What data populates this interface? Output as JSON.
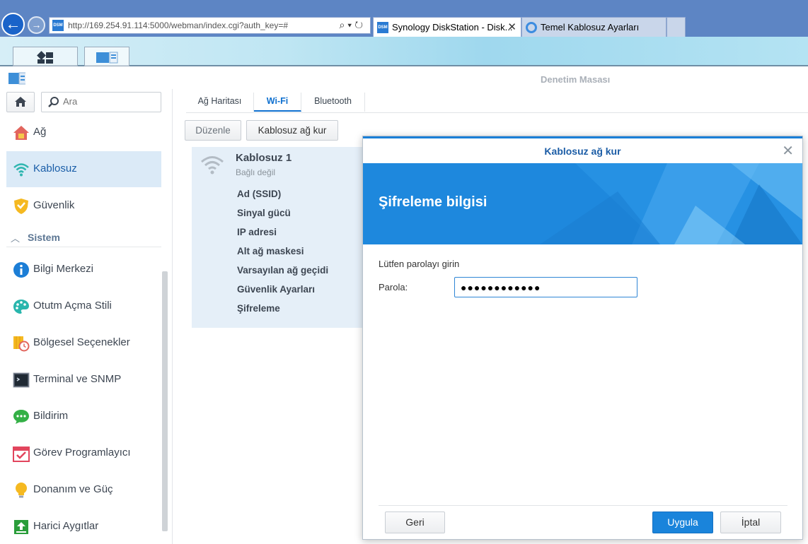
{
  "browser": {
    "address_url": "http://169.254.91.114:5000/webman/index.cgi?auth_key=#",
    "address_host": "169.254.91.114",
    "tabs": [
      {
        "label": "Synology DiskStation - Disk...",
        "close": "✕"
      },
      {
        "label": "Temel Kablosuz Ayarları"
      }
    ],
    "favicon_text": "DSM"
  },
  "window": {
    "title": "Denetim Masası"
  },
  "sidebar": {
    "search_placeholder": "Ara",
    "items_top": [
      {
        "label": "Ağ",
        "icon": "network-house-icon"
      },
      {
        "label": "Kablosuz",
        "icon": "wifi-icon",
        "active": true
      },
      {
        "label": "Güvenlik",
        "icon": "shield-icon"
      }
    ],
    "section_label": "Sistem",
    "items_system": [
      {
        "label": "Bilgi Merkezi",
        "icon": "info-icon"
      },
      {
        "label": "Otutm Açma Stili",
        "icon": "palette-icon"
      },
      {
        "label": "Bölgesel Seçenekler",
        "icon": "regional-clock-icon"
      },
      {
        "label": "Terminal ve SNMP",
        "icon": "terminal-icon"
      },
      {
        "label": "Bildirim",
        "icon": "chat-bubble-icon"
      },
      {
        "label": "Görev Programlayıcı",
        "icon": "calendar-check-icon"
      },
      {
        "label": "Donanım ve Güç",
        "icon": "lightbulb-icon"
      },
      {
        "label": "Harici Aygıtlar",
        "icon": "upload-device-icon"
      }
    ]
  },
  "main": {
    "tabs": [
      "Ağ Haritası",
      "Wi-Fi",
      "Bluetooth"
    ],
    "active_tab": "Wi-Fi",
    "toolbar": {
      "edit_label": "Düzenle",
      "setup_label": "Kablosuz ağ kur"
    },
    "wifi_panel": {
      "name": "Kablosuz 1",
      "status": "Bağlı değil",
      "fields": [
        "Ad (SSID)",
        "Sinyal gücü",
        "IP adresi",
        "Alt ağ maskesi",
        "Varsayılan ağ geçidi",
        "Güvenlik Ayarları",
        "Şifreleme"
      ]
    }
  },
  "dialog": {
    "title": "Kablosuz ağ kur",
    "heading": "Şifreleme bilgisi",
    "prompt": "Lütfen parolayı girin",
    "password_label": "Parola:",
    "password_value": "●●●●●●●●●●●●",
    "back_label": "Geri",
    "apply_label": "Uygula",
    "cancel_label": "İptal",
    "close": "✕"
  },
  "colors": {
    "accent": "#1a84db",
    "active_tab": "#0f70cf",
    "sidebar_active_bg": "#dbeaf7",
    "banner": "#1e88dd"
  }
}
